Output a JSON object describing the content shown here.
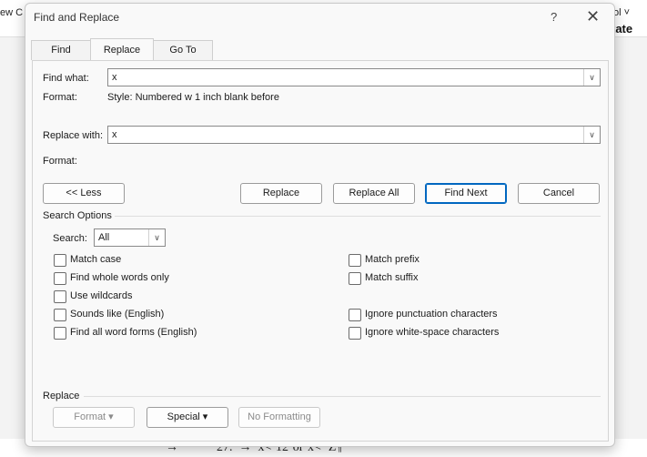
{
  "background": {
    "top_left_text": "ew C",
    "top_right_text": "ol ˅",
    "top_right_bold": "tate",
    "doc_line": "→            27.  →  x<·12·or·x<−Z¶"
  },
  "dialog": {
    "title": "Find and Replace",
    "help": "?",
    "close": "✕"
  },
  "tabs": [
    "Find",
    "Replace",
    "Go To"
  ],
  "find": {
    "label": "Find what:",
    "value": "x",
    "format_label": "Format:",
    "format_value": "Style: Numbered w 1 inch blank before"
  },
  "replace": {
    "label": "Replace with:",
    "value": "x",
    "format_label": "Format:"
  },
  "buttons": {
    "less": "<< Less",
    "replace": "Replace",
    "replace_all": "Replace All",
    "find_next": "Find Next",
    "cancel": "Cancel"
  },
  "search_options": {
    "heading": "Search Options",
    "search_label": "Search:",
    "search_value": "All",
    "left": [
      "Match case",
      "Find whole words only",
      "Use wildcards",
      "Sounds like (English)",
      "Find all word forms (English)"
    ],
    "right": [
      "Match prefix",
      "Match suffix",
      "Ignore punctuation characters",
      "Ignore white-space characters"
    ]
  },
  "replace_section": {
    "heading": "Replace",
    "format": "Format ▾",
    "special": "Special ▾",
    "no_formatting": "No Formatting"
  },
  "colors": {
    "accent": "#0067c0"
  }
}
